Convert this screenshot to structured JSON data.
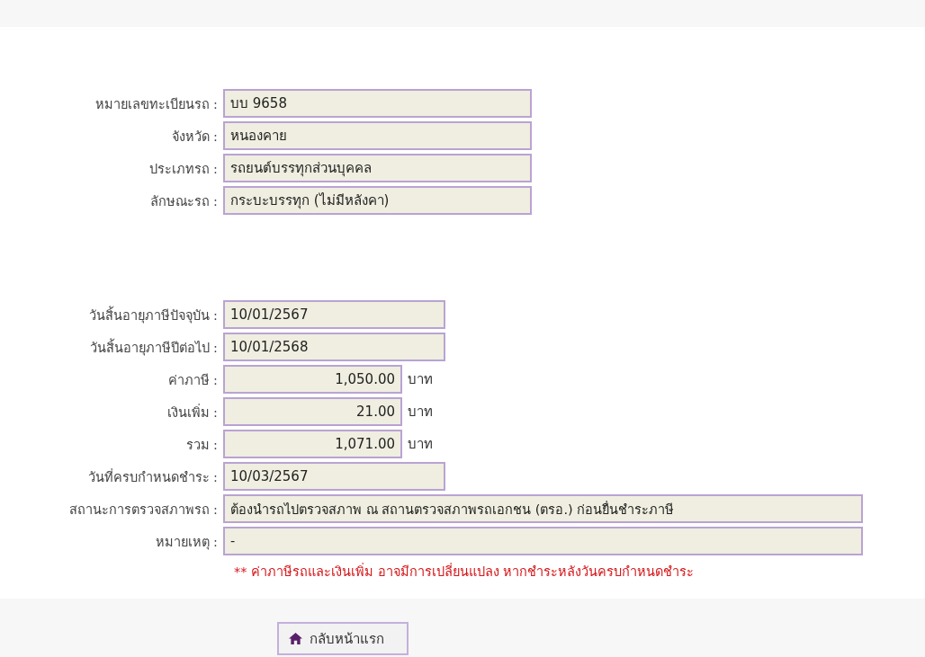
{
  "vehicle": [
    {
      "label": "หมายเลขทะเบียนรถ :",
      "value": "บบ 9658",
      "kind": "long"
    },
    {
      "label": "จังหวัด :",
      "value": "หนองคาย",
      "kind": "long"
    },
    {
      "label": "ประเภทรถ :",
      "value": "รถยนต์บรรทุกส่วนบุคคล",
      "kind": "long"
    },
    {
      "label": "ลักษณะรถ :",
      "value": "กระบะบรรทุก (ไม่มีหลังคา)",
      "kind": "long"
    }
  ],
  "tax": [
    {
      "label": "วันสิ้นอายุภาษีปัจจุบัน :",
      "value": "10/01/2567",
      "kind": "date"
    },
    {
      "label": "วันสิ้นอายุภาษีปีต่อไป :",
      "value": "10/01/2568",
      "kind": "date"
    },
    {
      "label": "ค่าภาษี :",
      "value": "1,050.00",
      "kind": "money",
      "unit": "บาท"
    },
    {
      "label": "เงินเพิ่ม :",
      "value": "21.00",
      "kind": "money",
      "unit": "บาท"
    },
    {
      "label": "รวม :",
      "value": "1,071.00",
      "kind": "money",
      "unit": "บาท"
    },
    {
      "label": "วันที่ครบกำหนดชำระ :",
      "value": "10/03/2567",
      "kind": "date"
    },
    {
      "label": "สถานะการตรวจสภาพรถ :",
      "value": "ต้องนำรถไปตรวจสภาพ ณ สถานตรวจสภาพรถเอกชน (ตรอ.) ก่อนยื่นชำระภาษี",
      "kind": "wide"
    },
    {
      "label": "หมายเหตุ :",
      "value": "-",
      "kind": "wide"
    }
  ],
  "note": "** ค่าภาษีรถและเงินเพิ่ม อาจมีการเปลี่ยนแปลง หากชำระหลังวันครบกำหนดชำระ",
  "home_button": "กลับหน้าแรก"
}
